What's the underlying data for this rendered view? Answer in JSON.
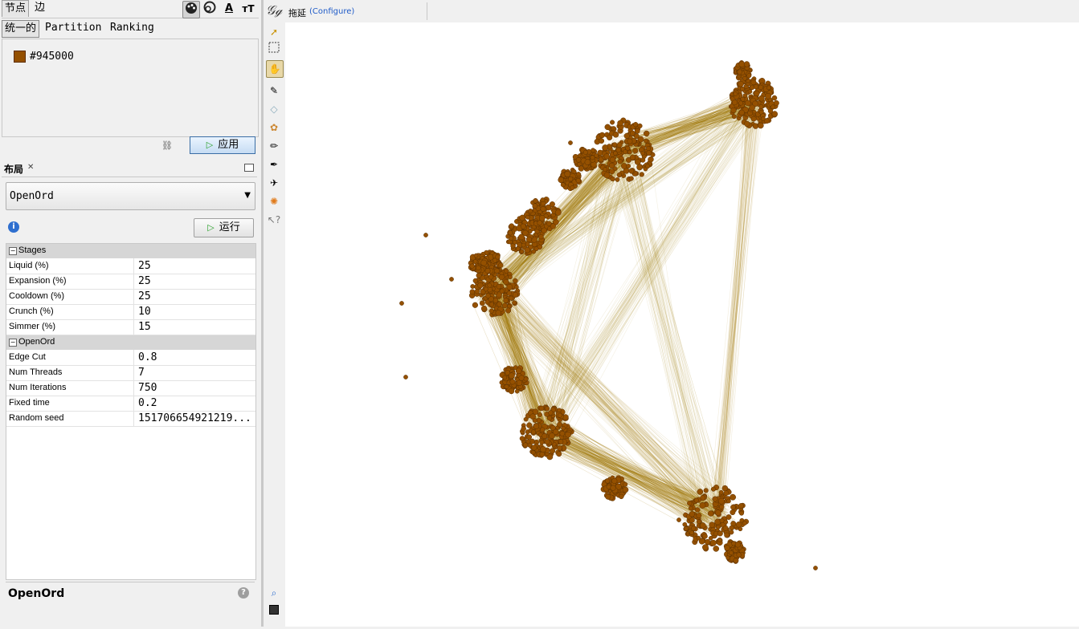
{
  "appearance": {
    "tabs": [
      "节点",
      "边"
    ],
    "subtabs": [
      "统一的",
      "Partition",
      "Ranking"
    ],
    "icons": [
      "palette-icon",
      "size-icon",
      "label-color-icon",
      "label-size-icon"
    ],
    "color_label": "#945000",
    "color": "#945000",
    "apply_label": "应用"
  },
  "layout": {
    "title": "布局",
    "algorithm": "OpenOrd",
    "run_label": "运行",
    "categories": [
      {
        "name": "Stages",
        "rows": [
          {
            "key": "Liquid (%)",
            "value": "25"
          },
          {
            "key": "Expansion (%)",
            "value": "25"
          },
          {
            "key": "Cooldown (%)",
            "value": "25"
          },
          {
            "key": "Crunch (%)",
            "value": "10"
          },
          {
            "key": "Simmer (%)",
            "value": "15"
          }
        ]
      },
      {
        "name": "OpenOrd",
        "rows": [
          {
            "key": "Edge Cut",
            "value": "0.8"
          },
          {
            "key": "Num Threads",
            "value": "7"
          },
          {
            "key": "Num Iterations",
            "value": "750"
          },
          {
            "key": "Fixed time",
            "value": "0.2"
          },
          {
            "key": "Random seed",
            "value": "151706654921219..."
          }
        ]
      }
    ],
    "description_title": "OpenOrd"
  },
  "graph": {
    "mode_label": "拖延",
    "configure_label": "(Configure)",
    "node_color": "#945000",
    "edge_color": "#a07800"
  }
}
